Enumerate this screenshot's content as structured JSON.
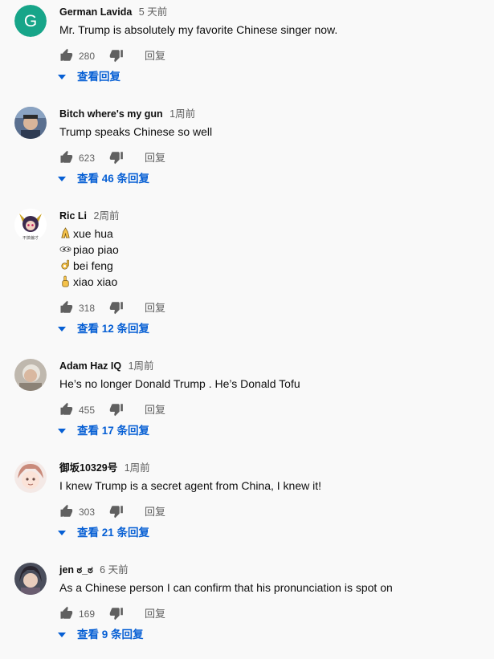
{
  "comments": [
    {
      "author": "German Lavida",
      "time": "5 天前",
      "lines": [
        "Mr. Trump is absolutely my favorite Chinese singer now."
      ],
      "likes": "280",
      "reply": "回复",
      "replies_label": "查看回复",
      "avatar_letter": "G",
      "avatar_color": "#17a589"
    },
    {
      "author": "Bitch where's my gun",
      "time": "1周前",
      "lines": [
        "Trump speaks Chinese so well"
      ],
      "likes": "623",
      "reply": "回复",
      "replies_label": "查看 46 条回复"
    },
    {
      "author": "Ric Li",
      "time": "2周前",
      "lines": [
        "xue hua",
        "piao piao",
        "bei feng",
        "xiao xiao"
      ],
      "line_icons": [
        "praying-hands-icon",
        "eyes-icon",
        "ok-hand-icon",
        "pointing-up-icon"
      ],
      "likes": "318",
      "reply": "回复",
      "replies_label": "查看 12 条回复",
      "avatar_caption": "不搞偏才"
    },
    {
      "author": "Adam Haz IQ",
      "time": "1周前",
      "lines": [
        "He’s no longer Donald Trump . He’s Donald Tofu"
      ],
      "likes": "455",
      "reply": "回复",
      "replies_label": "查看 17 条回复"
    },
    {
      "author": "御坂10329号",
      "time": "1周前",
      "lines": [
        "I knew Trump is a secret agent from China, I knew it!"
      ],
      "likes": "303",
      "reply": "回复",
      "replies_label": "查看 21 条回复"
    },
    {
      "author": "jen ಠ_ಠ",
      "time": "6 天前",
      "lines": [
        "As a Chinese person I can confirm that his pronunciation is spot on"
      ],
      "likes": "169",
      "reply": "回复",
      "replies_label": "查看 9 条回复"
    }
  ],
  "colors": {
    "link_blue": "#065fd4",
    "meta_gray": "#606060",
    "icon_gray": "#606060",
    "background": "#f9f9f9"
  }
}
